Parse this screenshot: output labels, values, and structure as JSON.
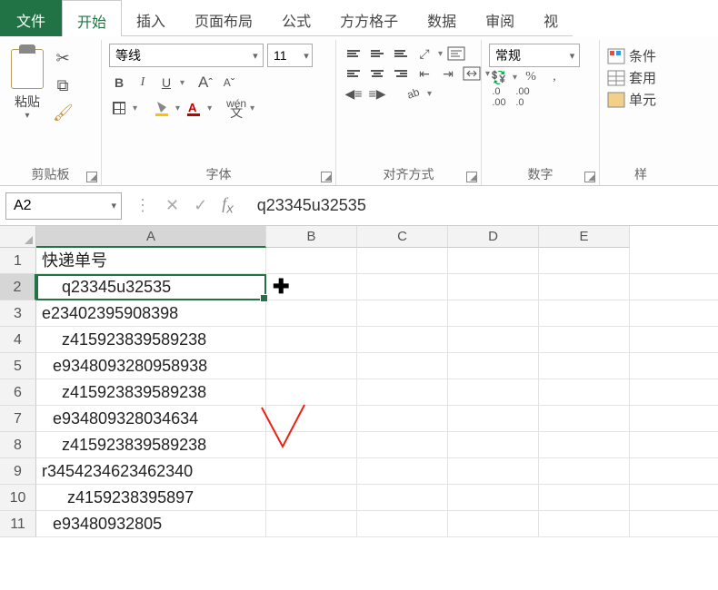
{
  "menu": {
    "file": "文件",
    "tabs": [
      "开始",
      "插入",
      "页面布局",
      "公式",
      "方方格子",
      "数据",
      "审阅",
      "视"
    ]
  },
  "ribbon": {
    "clipboard": {
      "paste": "粘贴",
      "label": "剪贴板"
    },
    "font": {
      "name": "等线",
      "size": "11",
      "label": "字体",
      "wen": "wén",
      "wen2": "文"
    },
    "align": {
      "label": "对齐方式"
    },
    "number": {
      "format": "常规",
      "label": "数字"
    },
    "styles": {
      "cond": "条件",
      "table": "套用",
      "cell": "单元",
      "label": "样"
    }
  },
  "formula_bar": {
    "name_box": "A2",
    "value": "q23345u32535"
  },
  "columns": [
    "A",
    "B",
    "C",
    "D",
    "E"
  ],
  "rows": [
    {
      "n": "1",
      "A": "快递单号"
    },
    {
      "n": "2",
      "A": "q23345u32535"
    },
    {
      "n": "3",
      "A": "e23402395908398"
    },
    {
      "n": "4",
      "A": "z415923839589238"
    },
    {
      "n": "5",
      "A": "e9348093280958938"
    },
    {
      "n": "6",
      "A": "z415923839589238"
    },
    {
      "n": "7",
      "A": "e934809328034634"
    },
    {
      "n": "8",
      "A": "z415923839589238"
    },
    {
      "n": "9",
      "A": "r3454234623462340"
    },
    {
      "n": "10",
      "A": "z4159238395897"
    },
    {
      "n": "11",
      "A": "e93480932805"
    }
  ],
  "selection": {
    "col": "A",
    "row": 2
  }
}
